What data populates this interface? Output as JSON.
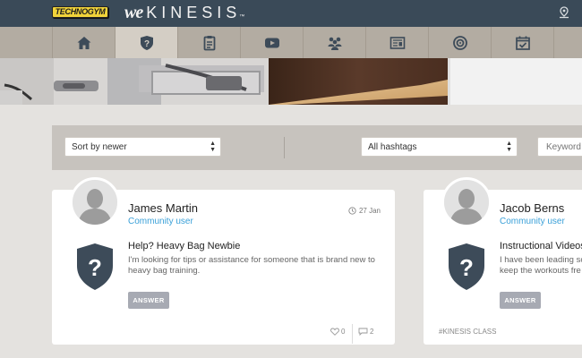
{
  "header": {
    "technogym_logo": "TECHNOGYM",
    "brand_we": "we",
    "brand_name": "KINESIS",
    "brand_tm": "™"
  },
  "nav": {
    "items": [
      {
        "icon": "home-icon",
        "active": false
      },
      {
        "icon": "question-shield-icon",
        "active": true
      },
      {
        "icon": "clipboard-icon",
        "active": false
      },
      {
        "icon": "video-play-icon",
        "active": false
      },
      {
        "icon": "community-icon",
        "active": false
      },
      {
        "icon": "news-icon",
        "active": false
      },
      {
        "icon": "target-icon",
        "active": false
      },
      {
        "icon": "calendar-check-icon",
        "active": false
      }
    ]
  },
  "filters": {
    "sort_value": "Sort by newer",
    "hashtag_value": "All hashtags",
    "keyword_placeholder": "Keyword"
  },
  "posts": [
    {
      "author": "James Martin",
      "role": "Community user",
      "date": "27 Jan",
      "title": "Help? Heavy Bag Newbie",
      "body_line1": "I'm looking for tips or assistance for someone that is brand new to",
      "body_line2": "heavy bag training.",
      "answer_label": "ANSWER",
      "likes": "0",
      "comments": "2",
      "hashtag": ""
    },
    {
      "author": "Jacob Berns",
      "role": "Community user",
      "date": "",
      "title": "Instructional Videos",
      "body_line1": "I have been leading so",
      "body_line2": "keep the workouts fre",
      "answer_label": "ANSWER",
      "likes": "",
      "comments": "",
      "hashtag": "#KINESIS CLASS"
    }
  ],
  "colors": {
    "topbar": "#3a4a58",
    "nav": "#b3aca2",
    "nav_active": "#d4cec5",
    "accent_link": "#3aa0d8",
    "shield": "#3d4b59",
    "answer_button": "#a7aab3"
  }
}
